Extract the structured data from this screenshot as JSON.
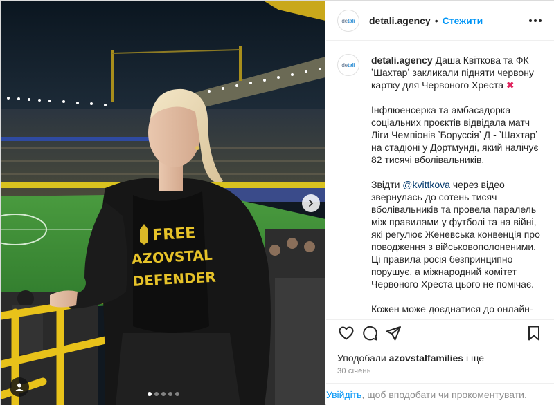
{
  "header": {
    "avatar_logo": {
      "prefix": "de",
      "highlight": "tali"
    },
    "username": "detali.agency",
    "separator": "•",
    "follow_label": "Стежити"
  },
  "media": {
    "shirt_text": [
      "FREE",
      "AZOVSTAL",
      "DEFENDER"
    ],
    "carousel": {
      "count": 5,
      "active_index": 0
    }
  },
  "caption": {
    "username": "detali.agency",
    "title": "Даша Квіткова та ФК ʼШахтарʼ закликали підняти червону картку для Червоного Хреста",
    "title_emoji": "✖",
    "paragraph_1": "Інфлюенсерка та амбасадорка соціальних проєктів відвідала матч Ліги Чемпіонів ʼБоруссіяʼ Д - ʼШахтарʼ на стадіоні у Дортмунді, який налічує 82 тисячі вболівальників.",
    "paragraph_2_prefix": "Звідти",
    "paragraph_2_mention": "@kvittkova",
    "paragraph_2_rest": "через відео звернулась до сотень тисяч вболівальників та провела паралель між правилами у футболі та на війні, які регулює Женевська конвенція про поводження з військовополоненими. Ці правила росія безпринципно порушує, а міжнародний комітет Червоного Хреста цього не помічає.",
    "paragraph_3": "Кожен може доєднатися до онлайн-"
  },
  "actions": {
    "icons": [
      "heart-icon",
      "comment-icon",
      "share-icon",
      "save-icon"
    ]
  },
  "likes": {
    "prefix": "Уподобали",
    "user": "azovstalfamilies",
    "suffix": "і ще"
  },
  "date": "30 січень",
  "footer": {
    "login_label": "Увійдіть",
    "rest": ", щоб вподобати чи прокоментувати."
  },
  "colors": {
    "accent": "#0095f6",
    "mention": "#00376b",
    "stadium_yellow": "#e8c21a",
    "pitch_green": "#3f8f3a",
    "shirt_print": "#e6c229"
  }
}
